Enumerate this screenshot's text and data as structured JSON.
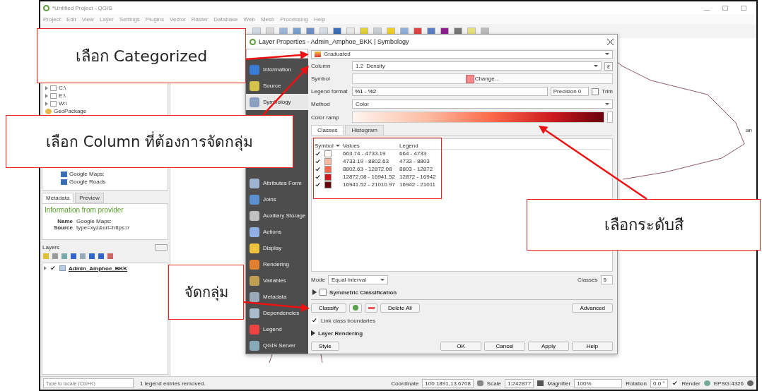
{
  "window": {
    "title": "*Untitled Project - QGIS"
  },
  "menu": [
    "Project",
    "Edit",
    "View",
    "Layer",
    "Settings",
    "Plugins",
    "Vector",
    "Raster",
    "Database",
    "Web",
    "Mesh",
    "Processing",
    "Help"
  ],
  "browser_items": [
    {
      "label": "C:\\",
      "kind": "folder"
    },
    {
      "label": "E:\\",
      "kind": "folder"
    },
    {
      "label": "W:\\",
      "kind": "folder"
    },
    {
      "label": "GeoPackage",
      "kind": "geopackage"
    },
    {
      "label": "Google Maps:",
      "kind": "tile"
    },
    {
      "label": "Google Roads",
      "kind": "tile"
    }
  ],
  "metadata_panel": {
    "tabs": [
      {
        "label": "Metadata",
        "selected": true
      },
      {
        "label": "Preview",
        "selected": false
      }
    ],
    "heading": "Information from provider",
    "fields": [
      {
        "label": "Name",
        "value": "Google Maps:"
      },
      {
        "label": "Source",
        "value": "type=xyz&url=https://"
      }
    ]
  },
  "layers_panel": {
    "title": "Layers",
    "layers": [
      {
        "name": "Admin_Amphoe_BKK",
        "checked": true
      }
    ]
  },
  "map": {
    "label": "an"
  },
  "status_bar": {
    "locate_placeholder": "Type to locate (Ctrl+K)",
    "message": "1 legend entries removed.",
    "coordinate_label": "Coordinate",
    "coordinate": "100.1891,13.6708",
    "scale_label": "Scale",
    "scale": "1:242877",
    "magnifier_label": "Magnifier",
    "magnifier": "100%",
    "rotation_label": "Rotation",
    "rotation": "0.0 °",
    "render_label": "Render",
    "render_checked": true,
    "crs": "EPSG:4326"
  },
  "dialog": {
    "title": "Layer Properties - Admin_Amphoe_BKK | Symbology",
    "sidebar": [
      {
        "label": "Information",
        "selected": false
      },
      {
        "label": "Source",
        "selected": false
      },
      {
        "label": "Symbology",
        "selected": true
      },
      {
        "label": "Attributes Form",
        "selected": false
      },
      {
        "label": "Joins",
        "selected": false
      },
      {
        "label": "Auxiliary Storage",
        "selected": false
      },
      {
        "label": "Actions",
        "selected": false
      },
      {
        "label": "Display",
        "selected": false
      },
      {
        "label": "Rendering",
        "selected": false
      },
      {
        "label": "Variables",
        "selected": false
      },
      {
        "label": "Metadata",
        "selected": false
      },
      {
        "label": "Dependencies",
        "selected": false
      },
      {
        "label": "Legend",
        "selected": false
      },
      {
        "label": "QGIS Server",
        "selected": false
      }
    ],
    "renderer": "Graduated",
    "column_label": "Column",
    "column_type": "1.2",
    "column": "Density",
    "expression_button": "ε",
    "symbol_label": "Symbol",
    "symbol_button": "Change...",
    "legend_format_label": "Legend format",
    "legend_format": "%1 - %2",
    "precision": "Precision 0",
    "trim_label": "Trim",
    "trim_checked": false,
    "method_label": "Method",
    "method": "Color",
    "color_ramp_label": "Color ramp",
    "tabs": [
      {
        "label": "Classes",
        "selected": true
      },
      {
        "label": "Histogram",
        "selected": false
      }
    ],
    "columns": [
      "Symbol",
      "Values",
      "Legend"
    ],
    "classes": [
      {
        "checked": true,
        "color": "#fff5f0",
        "values": "663.74 - 4733.19",
        "legend": "664 - 4733"
      },
      {
        "checked": true,
        "color": "#fcbba1",
        "values": "4733.19 - 8802.63",
        "legend": "4733 - 8803"
      },
      {
        "checked": true,
        "color": "#fb6a4a",
        "values": "8802.63 - 12872.08",
        "legend": "8803 - 12872"
      },
      {
        "checked": true,
        "color": "#cb181d",
        "values": "12872.08 - 16941.52",
        "legend": "12872 - 16942"
      },
      {
        "checked": true,
        "color": "#67000d",
        "values": "16941.52 - 21010.97",
        "legend": "16942 - 21011"
      }
    ],
    "mode_label": "Mode",
    "mode": "Equal Interval",
    "classes_label": "Classes",
    "classes_count": "5",
    "symmetric_label": "Symmetric Classification",
    "symmetric_checked": false,
    "classify_button": "Classify",
    "delete_all_button": "Delete All",
    "advanced_button": "Advanced",
    "link_label": "Link class boundaries",
    "link_checked": true,
    "layer_rendering": "Layer Rendering",
    "style_button": "Style",
    "footer_buttons": [
      "OK",
      "Cancel",
      "Apply",
      "Help"
    ]
  },
  "callouts": [
    {
      "text": "เลือก Categorized"
    },
    {
      "text": "เลือก Column ที่ต้องการจัดกลุ่ม"
    },
    {
      "text": "เลือกระดับสี"
    },
    {
      "text": "จัดกลุ่ม"
    }
  ]
}
